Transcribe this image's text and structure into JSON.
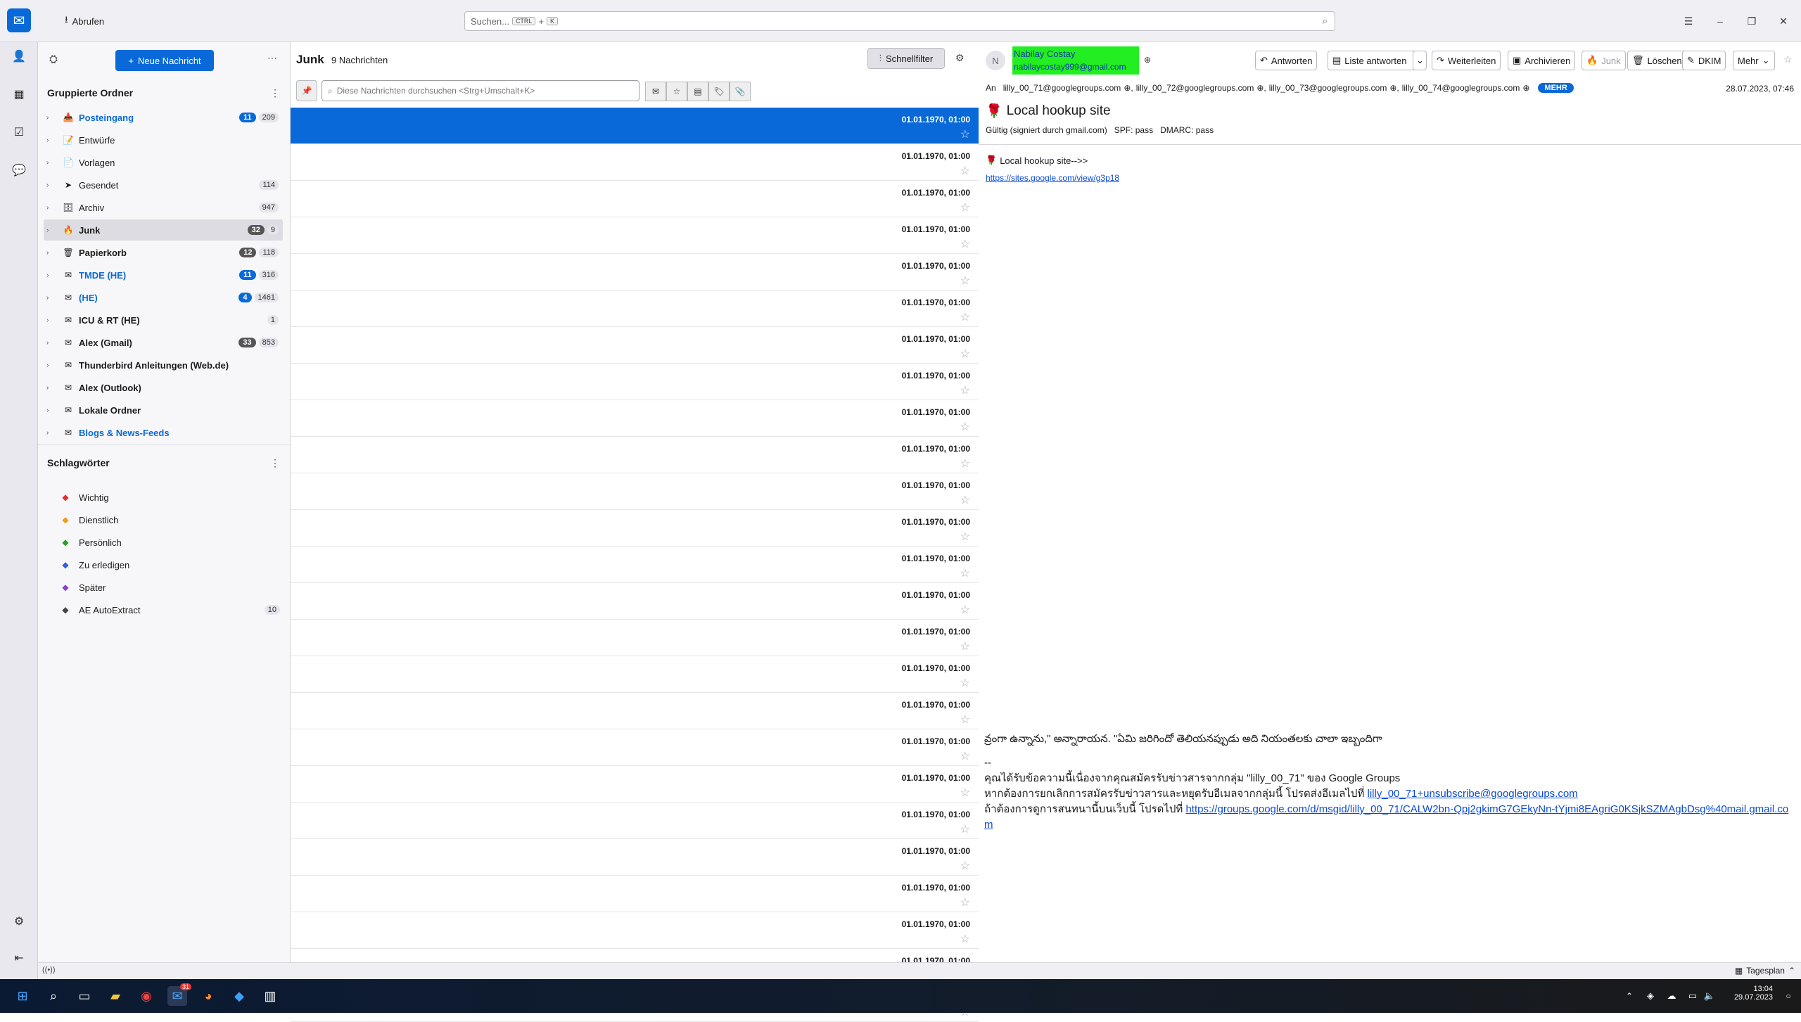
{
  "titlebar": {
    "fetch_label": "Abrufen",
    "search_placeholder": "Suchen...",
    "search_key1": "CTRL",
    "search_plus": "+",
    "search_key2": "K"
  },
  "folder_pane": {
    "new_message": "Neue Nachricht",
    "grouped_header": "Gruppierte Ordner",
    "folders": [
      {
        "name": "Posteingang",
        "unread": "11",
        "total": "209",
        "style": "blue"
      },
      {
        "name": "Entwürfe",
        "unread": "",
        "total": "",
        "style": "normal"
      },
      {
        "name": "Vorlagen",
        "unread": "",
        "total": "",
        "style": "normal"
      },
      {
        "name": "Gesendet",
        "unread": "",
        "total": "114",
        "style": "normal"
      },
      {
        "name": "Archiv",
        "unread": "",
        "total": "947",
        "style": "normal"
      },
      {
        "name": "Junk",
        "unread": "32",
        "total": "9",
        "style": "bold"
      },
      {
        "name": "Papierkorb",
        "unread": "12",
        "total": "118",
        "style": "bold"
      },
      {
        "name": "TMDE (HE)",
        "unread": "11",
        "total": "316",
        "style": "blue"
      },
      {
        "name": "(HE)",
        "unread": "4",
        "total": "1461",
        "style": "blue"
      },
      {
        "name": "ICU & RT (HE)",
        "unread": "",
        "total": "1",
        "style": "bold"
      },
      {
        "name": "Alex (Gmail)",
        "unread": "33",
        "total": "853",
        "style": "bold"
      },
      {
        "name": "Thunderbird Anleitungen (Web.de)",
        "unread": "",
        "total": "",
        "style": "bold"
      },
      {
        "name": "Alex (Outlook)",
        "unread": "",
        "total": "",
        "style": "bold"
      },
      {
        "name": "Lokale Ordner",
        "unread": "",
        "total": "",
        "style": "bold"
      },
      {
        "name": "Blogs & News-Feeds",
        "unread": "",
        "total": "",
        "style": "blue"
      }
    ],
    "tags_header": "Schlagwörter",
    "tags": [
      {
        "name": "Wichtig",
        "count": "",
        "color": "#e0302a"
      },
      {
        "name": "Dienstlich",
        "count": "",
        "color": "#e8a020"
      },
      {
        "name": "Persönlich",
        "count": "",
        "color": "#2aa02a"
      },
      {
        "name": "Zu erledigen",
        "count": "",
        "color": "#3060d8"
      },
      {
        "name": "Später",
        "count": "",
        "color": "#9040c8"
      },
      {
        "name": "AE AutoExtract",
        "count": "10",
        "color": "#444444"
      }
    ]
  },
  "message_list": {
    "folder_title": "Junk",
    "count_label": "9 Nachrichten",
    "quickfilter_label": "Schnellfilter",
    "filter_placeholder": "Diese Nachrichten durchsuchen <Strg+Umschalt+K>",
    "rows": [
      "01.01.1970, 01:00",
      "01.01.1970, 01:00",
      "01.01.1970, 01:00",
      "01.01.1970, 01:00",
      "01.01.1970, 01:00",
      "01.01.1970, 01:00",
      "01.01.1970, 01:00",
      "01.01.1970, 01:00",
      "01.01.1970, 01:00",
      "01.01.1970, 01:00",
      "01.01.1970, 01:00",
      "01.01.1970, 01:00",
      "01.01.1970, 01:00",
      "01.01.1970, 01:00",
      "01.01.1970, 01:00",
      "01.01.1970, 01:00",
      "01.01.1970, 01:00",
      "01.01.1970, 01:00",
      "01.01.1970, 01:00",
      "01.01.1970, 01:00",
      "01.01.1970, 01:00",
      "01.01.1970, 01:00",
      "01.01.1970, 01:00",
      "01.01.1970, 01:00",
      "01.01.1970, 01:00"
    ]
  },
  "reader": {
    "avatar_letter": "N",
    "sender_name": "Nabilay Costay",
    "sender_email": "nabilaycostay999@gmail.com",
    "actions": {
      "reply": "Antworten",
      "reply_list": "Liste antworten",
      "forward": "Weiterleiten",
      "archive": "Archivieren",
      "junk": "Junk",
      "delete": "Löschen",
      "dkim": "DKIM",
      "more": "Mehr"
    },
    "to_label": "An",
    "recipients": [
      "lilly_00_71@googlegroups.com",
      "lilly_00_72@googlegroups.com",
      "lilly_00_73@googlegroups.com",
      "lilly_00_74@googlegroups.com"
    ],
    "more_label": "MEHR",
    "date": "28.07.2023, 07:46",
    "subject": "Local hookup site",
    "signature": "Gültig (signiert durch gmail.com)",
    "spf": "SPF: pass",
    "dmarc": "DMARC: pass",
    "body_line": "Local hookup site-->>",
    "body_link": "https://sites.google.com/view/g3p18",
    "telugu_line": "వ్రంగా ఉన్నాను,\" అన్నారాయన. \"ఏమి జరిగిందో తెలియనప్పుడు అది నియంతలకు చాలా ఇబ్బందిగా",
    "sep": "--",
    "thai1": "คุณได้รับข้อความนี้เนื่องจากคุณสมัครรับข่าวสารจากกลุ่ม \"lilly_00_71\" ของ Google Groups",
    "thai2": "หากต้องการยกเลิกการสมัครรับข่าวสารและหยุดรับอีเมลจากกลุ่มนี้ โปรดส่งอีเมลไปที่",
    "thai2_link": "lilly_00_71+unsubscribe@googlegroups.com",
    "thai3": "ถ้าต้องการดูการสนทนานี้บนเว็บนี้ โปรดไปที่",
    "thai3_link": "https://groups.google.com/d/msgid/lilly_00_71/CALW2bn-Qpj2gkimG7GEkyNn-tYjmi8EAgriG0KSjkSZMAgbDsg%40mail.gmail.com"
  },
  "statusbar": {
    "today_label": "Tagesplan"
  },
  "taskbar": {
    "time": "13:04",
    "date": "29.07.2023",
    "badge": "31"
  }
}
